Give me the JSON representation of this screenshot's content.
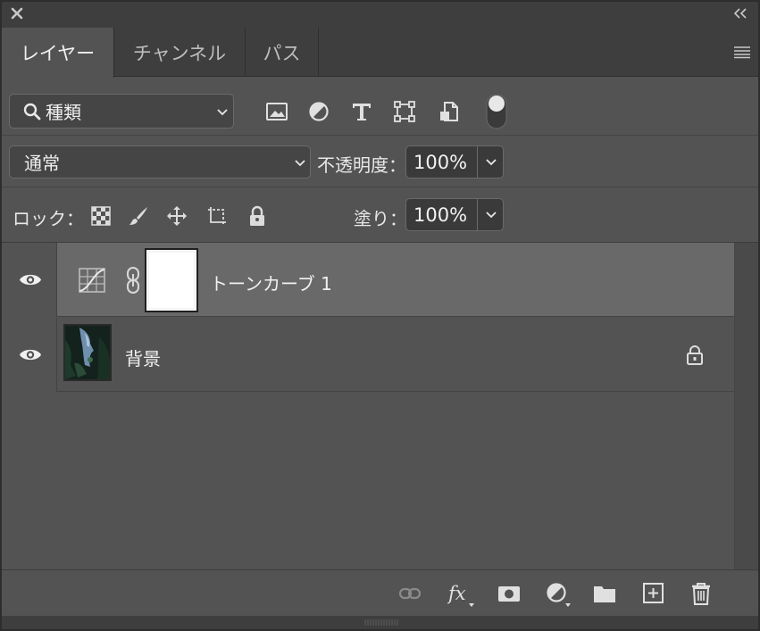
{
  "tabs": [
    {
      "label": "レイヤー",
      "active": true
    },
    {
      "label": "チャンネル",
      "active": false
    },
    {
      "label": "パス",
      "active": false
    }
  ],
  "filter": {
    "kind_label": "種類",
    "icons": [
      "pixel-layer-filter-icon",
      "adjustment-layer-filter-icon",
      "type-layer-filter-icon",
      "shape-layer-filter-icon",
      "smart-object-filter-icon",
      "filter-toggle-switch"
    ]
  },
  "blend": {
    "mode": "通常",
    "opacity_label": "不透明度：",
    "opacity_value": "100%"
  },
  "lock": {
    "label": "ロック：",
    "icons": [
      "lock-transparent-pixels-icon",
      "lock-image-pixels-icon",
      "lock-position-icon",
      "lock-artboard-icon",
      "lock-all-icon"
    ],
    "fill_label": "塗り：",
    "fill_value": "100%"
  },
  "layers": [
    {
      "name": "トーンカーブ 1",
      "type": "adjustment",
      "selected": true,
      "visible": true
    },
    {
      "name": "背景",
      "type": "image",
      "selected": false,
      "visible": true,
      "locked": true
    }
  ],
  "footer_icons": [
    "link-layers-icon",
    "fx-icon",
    "add-mask-icon",
    "new-adjustment-layer-icon",
    "new-group-icon",
    "new-layer-icon",
    "delete-layer-icon"
  ],
  "colors": {
    "panel_bg": "#535353",
    "selected_layer_bg": "#696969",
    "tab_bar_bg": "#3e3e3e",
    "text": "#f0f0f0"
  }
}
